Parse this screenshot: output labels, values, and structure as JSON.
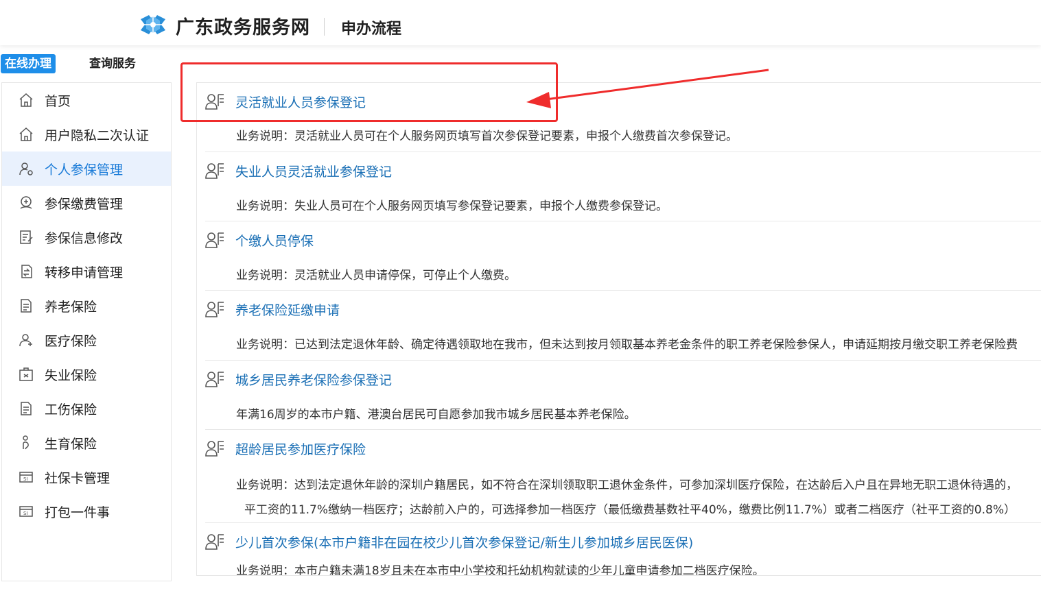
{
  "header": {
    "site_name": "广东政务服务网",
    "page_title": "申办流程"
  },
  "tabs": [
    {
      "label": "在线办理",
      "active": true
    },
    {
      "label": "查询服务",
      "active": false
    }
  ],
  "sidebar": {
    "items": [
      {
        "label": "首页",
        "icon": "home-icon"
      },
      {
        "label": "用户隐私二次认证",
        "icon": "home-icon"
      },
      {
        "label": "个人参保管理",
        "icon": "user-gear-icon",
        "active": true
      },
      {
        "label": "参保缴费管理",
        "icon": "payment-icon"
      },
      {
        "label": "参保信息修改",
        "icon": "edit-doc-icon"
      },
      {
        "label": "转移申请管理",
        "icon": "transfer-icon"
      },
      {
        "label": "养老保险",
        "icon": "doc-list-icon"
      },
      {
        "label": "医疗保险",
        "icon": "user-med-icon"
      },
      {
        "label": "失业保险",
        "icon": "briefcase-icon"
      },
      {
        "label": "工伤保险",
        "icon": "doc-list-icon"
      },
      {
        "label": "生育保险",
        "icon": "maternity-icon"
      },
      {
        "label": "社保卡管理",
        "icon": "si-card-icon"
      },
      {
        "label": "打包一件事",
        "icon": "si-card-icon"
      }
    ]
  },
  "services": [
    {
      "title": "灵活就业人员参保登记",
      "desc": "业务说明：灵活就业人员可在个人服务网页填写首次参保登记要素，申报个人缴费首次参保登记。"
    },
    {
      "title": "失业人员灵活就业参保登记",
      "desc": "业务说明：失业人员可在个人服务网页填写参保登记要素，申报个人缴费参保登记。"
    },
    {
      "title": "个缴人员停保",
      "desc": "业务说明：灵活就业人员申请停保，可停止个人缴费。"
    },
    {
      "title": "养老保险延缴申请",
      "desc": "业务说明：已达到法定退休年龄、确定待遇领取地在我市，但未达到按月领取基本养老金条件的职工养老保险参保人，申请延期按月缴交职工养老保险费"
    },
    {
      "title": "城乡居民养老保险参保登记",
      "desc": "年满16周岁的本市户籍、港澳台居民可自愿参加我市城乡居民基本养老保险。"
    },
    {
      "title": "超龄居民参加医疗保险",
      "desc": "业务说明：达到法定退休年龄的深圳户籍居民，如不符合在深圳领取职工退休金条件，可参加深圳医疗保险，在达龄后入户且在异地无职工退休待遇的，",
      "desc2": "平工资的11.7%缴纳一档医疗；达龄前入户的，可选择参加一档医疗（最低缴费基数社平40%，缴费比例11.7%）或者二档医疗（社平工资的0.8%）"
    },
    {
      "title": "少儿首次参保(本市户籍非在园在校少儿首次参保登记/新生儿参加城乡居民医保)",
      "desc": "业务说明：本市户籍未满18岁且未在本市中小学校和托幼机构就读的少年儿童申请参加二档医疗保险。"
    }
  ],
  "colors": {
    "accent": "#1e8ee9",
    "link": "#1a6fb5",
    "annotation": "#ef2c2c",
    "active_bg": "#e9f1fd"
  }
}
